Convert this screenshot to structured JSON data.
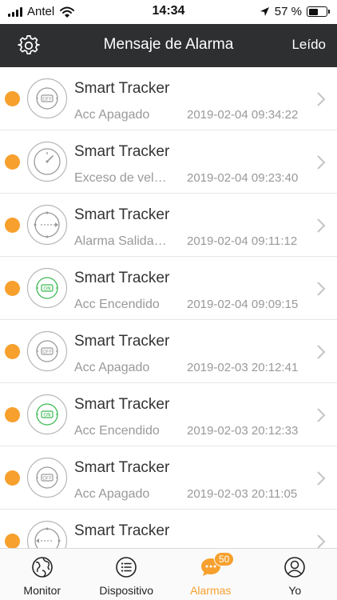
{
  "status_bar": {
    "carrier": "Antel",
    "time": "14:34",
    "battery_percent_text": "57 %",
    "battery_level": 0.57
  },
  "navbar": {
    "title": "Mensaje de Alarma",
    "right_label": "Leído",
    "left_icon": "gear-icon"
  },
  "alarms": [
    {
      "title": "Smart Tracker",
      "type": "Acc Apagado",
      "time": "2019-02-04 09:34:22",
      "icon": "acc-off-icon"
    },
    {
      "title": "Smart Tracker",
      "type": "Exceso de vel…",
      "time": "2019-02-04 09:23:40",
      "icon": "speedometer-icon"
    },
    {
      "title": "Smart Tracker",
      "type": "Alarma Salida…",
      "time": "2019-02-04 09:11:12",
      "icon": "geofence-exit-icon"
    },
    {
      "title": "Smart Tracker",
      "type": "Acc Encendido",
      "time": "2019-02-04 09:09:15",
      "icon": "acc-on-icon"
    },
    {
      "title": "Smart Tracker",
      "type": "Acc Apagado",
      "time": "2019-02-03 20:12:41",
      "icon": "acc-off-icon"
    },
    {
      "title": "Smart Tracker",
      "type": "Acc Encendido",
      "time": "2019-02-03 20:12:33",
      "icon": "acc-on-icon"
    },
    {
      "title": "Smart Tracker",
      "type": "Acc Apagado",
      "time": "2019-02-03 20:11:05",
      "icon": "acc-off-icon"
    },
    {
      "title": "Smart Tracker",
      "type": "",
      "time": "",
      "icon": "geofence-enter-icon"
    }
  ],
  "tabs": [
    {
      "label": "Monitor",
      "icon": "globe-icon",
      "active": false
    },
    {
      "label": "Dispositivo",
      "icon": "list-icon",
      "active": false
    },
    {
      "label": "Alarmas",
      "icon": "chat-icon",
      "active": true,
      "badge": "50"
    },
    {
      "label": "Yo",
      "icon": "person-icon",
      "active": false
    }
  ],
  "colors": {
    "accent": "#f7a02e",
    "navbar": "#2e2f31",
    "acc_on_green": "#3dbb55",
    "icon_gray": "#9a9a9a"
  }
}
